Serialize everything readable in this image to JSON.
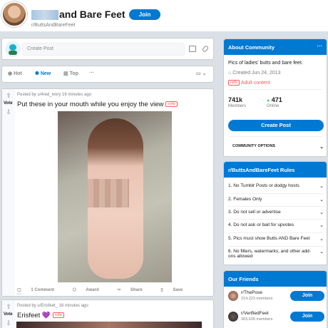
{
  "header": {
    "title": "and Bare Feet",
    "subreddit": "r/ButtsAndBareFeet",
    "join_label": "Join"
  },
  "create_post": {
    "placeholder": "Create Post",
    "icons": [
      "image-icon",
      "link-icon"
    ]
  },
  "sort": {
    "items": [
      {
        "label": "Hot",
        "icon": "flame-icon",
        "active": false
      },
      {
        "label": "New",
        "icon": "sparkle-icon",
        "active": true
      },
      {
        "label": "Top",
        "icon": "chart-icon",
        "active": false
      }
    ],
    "more": "···",
    "view_icon": "card-view-icon"
  },
  "posts": [
    {
      "vote_label": "Vote",
      "meta": "Posted by u/4red_ivory 16 minutes ago",
      "title": "Put these in your mouth while you enjoy the view",
      "flair": "nsfw",
      "actions": {
        "comments": "1 Comment",
        "award": "Award",
        "share": "Share",
        "save": "Save",
        "more": "···"
      }
    },
    {
      "vote_label": "Vote",
      "meta": "Posted by u/Erisfeet_ 16 minutes ago",
      "title": "Erisfeet",
      "emoji": "💜",
      "flair": "nsfw"
    }
  ],
  "about": {
    "heading": "About Community",
    "more": "···",
    "description": "Pics of ladies' butts and bare feet.",
    "created": "Created Jun 24, 2013",
    "nsfw_tag": "nsfw",
    "adult_label": "Adult content",
    "members_value": "741k",
    "members_label": "Members",
    "online_value": "471",
    "online_label": "Online",
    "create_post_label": "Create Post",
    "options_label": "COMMUNITY OPTIONS",
    "accent_color": "#0079d3",
    "online_color": "#46d160"
  },
  "rules": {
    "heading": "r/ButtsAndBareFeet Rules",
    "items": [
      "1. No Tumblr Posts or dodgy hosts",
      "2. Females Only",
      "3. Do not sell or advertise",
      "4. Do not ask or bait for upvotes",
      "5. Pics must show Butts AND Bare Feet",
      "6. No filters, watermarks, and other add-ons allowed"
    ]
  },
  "friends": {
    "heading": "Our Friends",
    "items": [
      {
        "name": "r/ThePose",
        "members": "214,223 members",
        "join": "Join"
      },
      {
        "name": "r/VerifiedFeet",
        "members": "303,635 members",
        "join": "Join"
      }
    ]
  }
}
